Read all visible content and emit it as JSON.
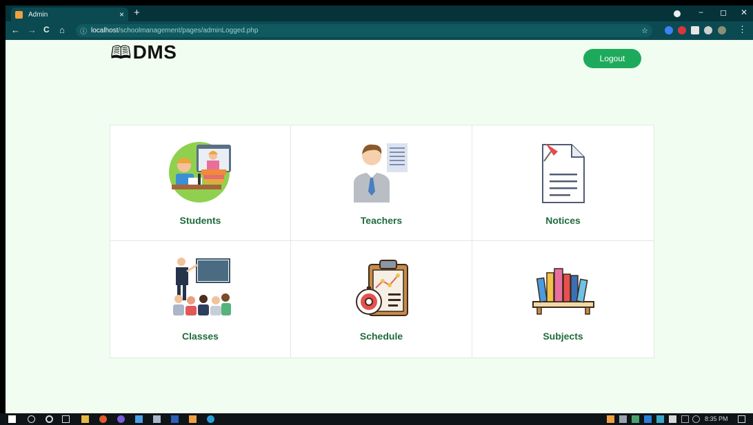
{
  "browser": {
    "tab_title": "Admin",
    "tab_close": "×",
    "new_tab": "+",
    "url_host": "localhost",
    "url_path": "/schoolmanagement/pages/adminLogged.php",
    "info_icon": "ⓘ",
    "star_icon": "☆",
    "back": "←",
    "forward": "→",
    "reload": "C",
    "home": "⌂",
    "minimize": "−",
    "restore": "◻",
    "close": "✕"
  },
  "header": {
    "logo_icon": "🕮",
    "logo_text": "DMS",
    "logout_label": "Logout"
  },
  "dashboard": {
    "cards": [
      {
        "label": "Students",
        "icon": "students-icon"
      },
      {
        "label": "Teachers",
        "icon": "teacher-icon"
      },
      {
        "label": "Notices",
        "icon": "notice-icon"
      },
      {
        "label": "Classes",
        "icon": "classroom-icon"
      },
      {
        "label": "Schedule",
        "icon": "schedule-icon"
      },
      {
        "label": "Subjects",
        "icon": "books-icon"
      }
    ]
  },
  "taskbar": {
    "time": "8:35 PM"
  },
  "colors": {
    "page_bg": "#f1fdf0",
    "accent": "#1eaa5c",
    "label": "#1f6b3c",
    "browser_dark": "#06333a"
  }
}
